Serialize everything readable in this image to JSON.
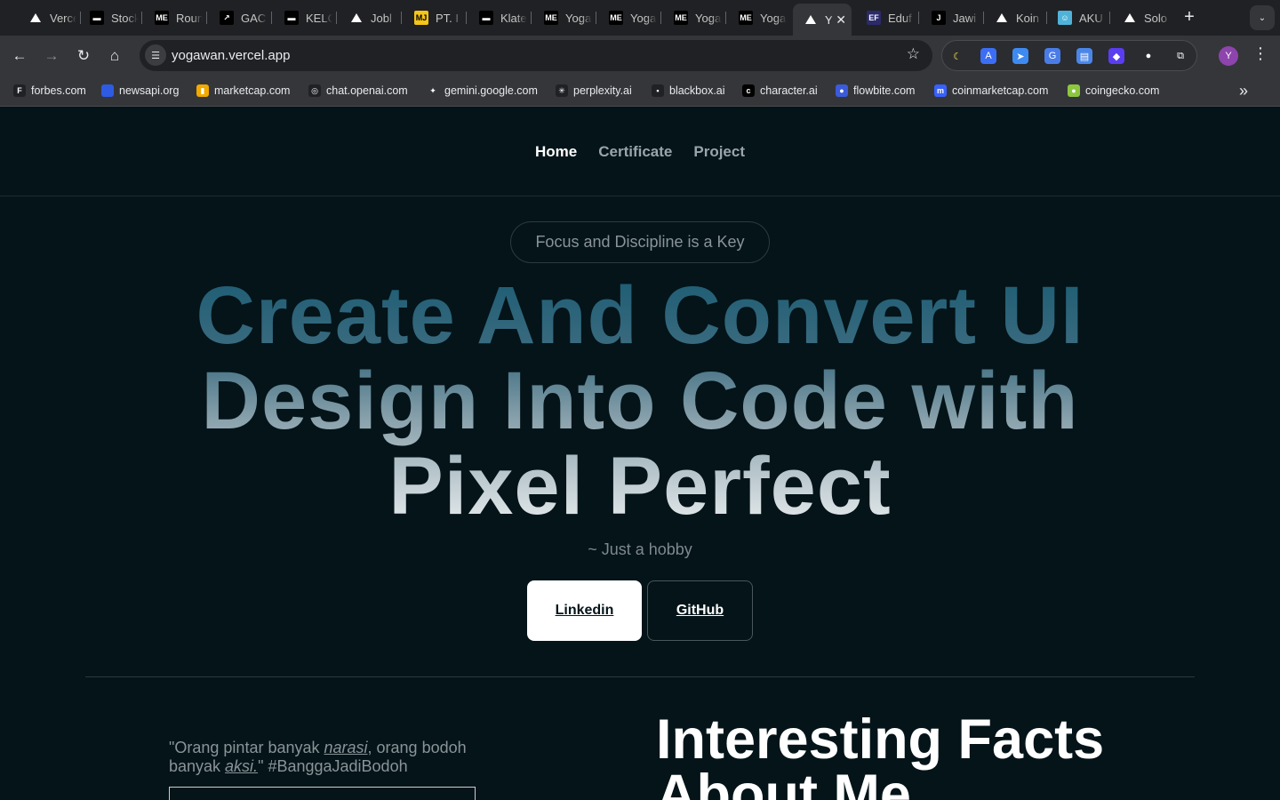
{
  "browser": {
    "tabs": [
      {
        "title": "Vercel",
        "icon": "vercel-triangle-icon",
        "color": "#000000"
      },
      {
        "title": "Stockbit",
        "icon": "stockbit-icon",
        "color": "#000000"
      },
      {
        "title": "Round",
        "icon": "me-icon",
        "color": "#000000"
      },
      {
        "title": "GAC",
        "icon": "gac-icon",
        "color": "#000000"
      },
      {
        "title": "KELC",
        "icon": "kelc-icon",
        "color": "#000000"
      },
      {
        "title": "Jobl",
        "icon": "vercel-triangle-icon",
        "color": "#000000"
      },
      {
        "title": "PT. I",
        "icon": "mj-icon",
        "color": "#f5c518"
      },
      {
        "title": "Klate",
        "icon": "klate-icon",
        "color": "#000000"
      },
      {
        "title": "Yoga",
        "icon": "me-icon",
        "color": "#000000"
      },
      {
        "title": "Yoga",
        "icon": "me-icon",
        "color": "#000000"
      },
      {
        "title": "Yoga",
        "icon": "me-icon",
        "color": "#000000"
      },
      {
        "title": "Yoga",
        "icon": "me-icon",
        "color": "#000000"
      },
      {
        "title": "Y",
        "icon": "vercel-triangle-icon",
        "color": "#000000",
        "active": true
      },
      {
        "title": "Eduf",
        "icon": "ef-icon",
        "color": "#2b2a6b"
      },
      {
        "title": "Jawi",
        "icon": "j-icon",
        "color": "#000000"
      },
      {
        "title": "Koin",
        "icon": "vercel-triangle-icon",
        "color": "#000000"
      },
      {
        "title": "AKU",
        "icon": "aku-icon",
        "color": "#4fb3d9"
      },
      {
        "title": "Solo",
        "icon": "vercel-triangle-icon",
        "color": "#000000"
      }
    ],
    "url": "yogawan.vercel.app",
    "avatar_letter": "Y",
    "extensions": [
      {
        "name": "moon-icon",
        "color": "#f2e94e",
        "glyph": "☾"
      },
      {
        "name": "translate-a-icon",
        "color": "#3b6ef5",
        "glyph": "A"
      },
      {
        "name": "compass-icon",
        "color": "#3d8bf2",
        "glyph": "➤"
      },
      {
        "name": "google-translate-icon",
        "color": "#4a7ce8",
        "glyph": "G"
      },
      {
        "name": "docs-icon",
        "color": "#4a86e8",
        "glyph": "▤"
      },
      {
        "name": "pinwheel-icon",
        "color": "#5a3df0",
        "glyph": "◆"
      },
      {
        "name": "record-icon",
        "color": "#ffffff",
        "glyph": "●"
      },
      {
        "name": "puzzle-icon",
        "color": "#35363a",
        "glyph": "⧉"
      }
    ],
    "bookmarks": [
      {
        "label": "forbes.com",
        "icon": "forbes-icon",
        "glyph": "F",
        "color": "#202124"
      },
      {
        "label": "newsapi.org",
        "icon": "newsapi-icon",
        "glyph": "",
        "color": "#2d5be3"
      },
      {
        "label": "marketcap.com",
        "icon": "bars-chart-icon",
        "glyph": "▮",
        "color": "#f2a900"
      },
      {
        "label": "chat.openai.com",
        "icon": "openai-icon",
        "glyph": "◎",
        "color": "#202124"
      },
      {
        "label": "gemini.google.com",
        "icon": "gemini-icon",
        "glyph": "✦",
        "color": "#35363a"
      },
      {
        "label": "perplexity.ai",
        "icon": "perplexity-icon",
        "glyph": "✳",
        "color": "#202124"
      },
      {
        "label": "blackbox.ai",
        "icon": "blackbox-icon",
        "glyph": "▪",
        "color": "#202124"
      },
      {
        "label": "character.ai",
        "icon": "character-ai-icon",
        "glyph": "c",
        "color": "#000000"
      },
      {
        "label": "flowbite.com",
        "icon": "flowbite-icon",
        "glyph": "●",
        "color": "#3b5bdb"
      },
      {
        "label": "coinmarketcap.com",
        "icon": "coinmarketcap-icon",
        "glyph": "m",
        "color": "#3861fb"
      },
      {
        "label": "coingecko.com",
        "icon": "coingecko-icon",
        "glyph": "●",
        "color": "#8dc63f"
      }
    ]
  },
  "site": {
    "nav": [
      {
        "label": "Home",
        "active": true
      },
      {
        "label": "Certificate",
        "active": false
      },
      {
        "label": "Project",
        "active": false
      }
    ],
    "pill": "Focus and Discipline is a Key",
    "headline": [
      "Create And Convert UI",
      "Design Into Code with",
      "Pixel Perfect"
    ],
    "subtitle": "~ Just a hobby",
    "buttons": {
      "linkedin": "Linkedin",
      "github": "GitHub"
    },
    "quote": {
      "part1": "\"Orang pintar banyak ",
      "em1": "narasi",
      "part2": ", orang bodoh banyak ",
      "em2": "aksi.",
      "part3": "\" #BanggaJadiBodoh"
    },
    "facts_title": "Interesting Facts About Me"
  }
}
